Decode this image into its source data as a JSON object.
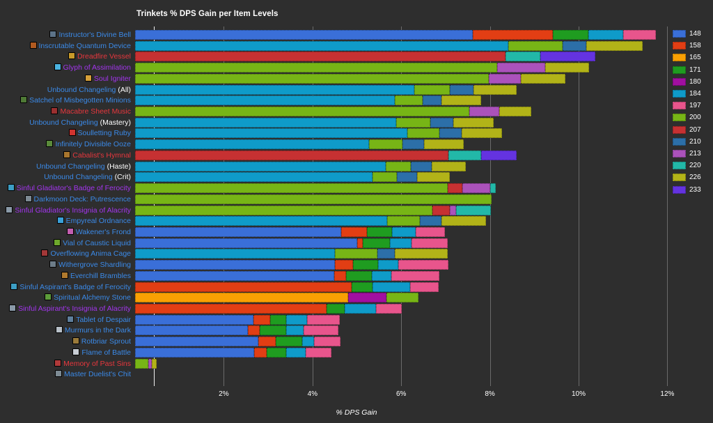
{
  "chart_data": {
    "type": "bar",
    "orientation": "horizontal",
    "stacked": true,
    "title": "Trinkets % DPS Gain per Item Levels",
    "xlabel": "% DPS Gain",
    "ylabel": "",
    "xlim": [
      0,
      12.6
    ],
    "xticks": [
      "2%",
      "4%",
      "6%",
      "8%",
      "10%",
      "12%"
    ],
    "xtick_values": [
      2,
      4,
      6,
      8,
      10,
      12
    ],
    "grid": true,
    "legend_position": "right",
    "legend_title": "",
    "series": [
      {
        "name": "148",
        "color": "#3a6fd8"
      },
      {
        "name": "158",
        "color": "#e23e14"
      },
      {
        "name": "165",
        "color": "#f9a003"
      },
      {
        "name": "171",
        "color": "#1f9c20"
      },
      {
        "name": "180",
        "color": "#a10fa1"
      },
      {
        "name": "184",
        "color": "#0f9bc9"
      },
      {
        "name": "197",
        "color": "#e8558c"
      },
      {
        "name": "200",
        "color": "#77b516"
      },
      {
        "name": "207",
        "color": "#c63132"
      },
      {
        "name": "210",
        "color": "#2c6fa8"
      },
      {
        "name": "213",
        "color": "#ab52bb"
      },
      {
        "name": "220",
        "color": "#22b8a8"
      },
      {
        "name": "226",
        "color": "#b2b318"
      },
      {
        "name": "233",
        "color": "#6433e0"
      }
    ],
    "categories": [
      {
        "label": "Instructor's Divine Bell",
        "suffix": "",
        "quality": "#3b8ae8",
        "icon": "#5d7388",
        "icon_name": "trinket-icon-instructors-divine-bell",
        "segments": [
          {
            "series": "148",
            "value": 7.62
          },
          {
            "series": "158",
            "value": 1.8
          },
          {
            "series": "171",
            "value": 0.8
          },
          {
            "series": "184",
            "value": 0.78
          },
          {
            "series": "197",
            "value": 0.74
          }
        ],
        "total": 11.74
      },
      {
        "label": "Inscrutable Quantum Device",
        "suffix": "",
        "quality": "#3b8ae8",
        "icon": "#b05a20",
        "icon_name": "trinket-icon-inscrutable-quantum-device",
        "segments": [
          {
            "series": "184",
            "value": 8.42
          },
          {
            "series": "200",
            "value": 1.22
          },
          {
            "series": "210",
            "value": 0.54
          },
          {
            "series": "226",
            "value": 1.26
          }
        ],
        "total": 11.44
      },
      {
        "label": "Dreadfire Vessel",
        "suffix": "",
        "quality": "#e8373d",
        "icon": "#c79a2a",
        "icon_name": "trinket-icon-dreadfire-vessel",
        "segments": [
          {
            "series": "207",
            "value": 8.35
          },
          {
            "series": "220",
            "value": 0.78
          },
          {
            "series": "233",
            "value": 1.25
          }
        ],
        "total": 10.38
      },
      {
        "label": "Glyph of Assimilation",
        "suffix": "",
        "quality": "#a335ee",
        "icon": "#4ab3e0",
        "icon_name": "trinket-icon-glyph-of-assimilation",
        "segments": [
          {
            "series": "200",
            "value": 8.17
          },
          {
            "series": "213",
            "value": 1.08
          },
          {
            "series": "226",
            "value": 0.99
          }
        ],
        "total": 10.24
      },
      {
        "label": "Soul Igniter",
        "suffix": "",
        "quality": "#a335ee",
        "icon": "#d6a03a",
        "icon_name": "trinket-icon-soul-igniter",
        "segments": [
          {
            "series": "200",
            "value": 7.97
          },
          {
            "series": "213",
            "value": 0.73
          },
          {
            "series": "226",
            "value": 1.0
          }
        ],
        "total": 9.7
      },
      {
        "label": "Unbound Changeling",
        "suffix": " (All)",
        "quality": "#3b8ae8",
        "icon": "",
        "icon_name": "",
        "segments": [
          {
            "series": "184",
            "value": 6.3
          },
          {
            "series": "200",
            "value": 0.8
          },
          {
            "series": "210",
            "value": 0.53
          },
          {
            "series": "226",
            "value": 0.97
          }
        ],
        "total": 8.6
      },
      {
        "label": "Satchel of Misbegotten Minions",
        "suffix": "",
        "quality": "#3b8ae8",
        "icon": "#4f7a36",
        "icon_name": "trinket-icon-satchel-of-misbegotten-minions",
        "segments": [
          {
            "series": "184",
            "value": 5.86
          },
          {
            "series": "200",
            "value": 0.62
          },
          {
            "series": "210",
            "value": 0.42
          },
          {
            "series": "226",
            "value": 0.91
          }
        ],
        "total": 7.81
      },
      {
        "label": "Macabre Sheet Music",
        "suffix": "",
        "quality": "#e8373d",
        "icon": "#9a3030",
        "icon_name": "trinket-icon-macabre-sheet-music",
        "segments": [
          {
            "series": "200",
            "value": 7.53
          },
          {
            "series": "213",
            "value": 0.68
          },
          {
            "series": "226",
            "value": 0.72
          }
        ],
        "total": 8.93
      },
      {
        "label": "Unbound Changeling",
        "suffix": " (Mastery)",
        "quality": "#3b8ae8",
        "icon": "",
        "icon_name": "",
        "segments": [
          {
            "series": "184",
            "value": 5.88
          },
          {
            "series": "200",
            "value": 0.78
          },
          {
            "series": "210",
            "value": 0.52
          },
          {
            "series": "226",
            "value": 0.91
          }
        ],
        "total": 8.09
      },
      {
        "label": "Soulletting Ruby",
        "suffix": "",
        "quality": "#3b8ae8",
        "icon": "#d0342f",
        "icon_name": "trinket-icon-soulletting-ruby",
        "segments": [
          {
            "series": "184",
            "value": 6.14
          },
          {
            "series": "200",
            "value": 0.72
          },
          {
            "series": "210",
            "value": 0.5
          },
          {
            "series": "226",
            "value": 0.92
          }
        ],
        "total": 8.28
      },
      {
        "label": "Infinitely Divisible Ooze",
        "suffix": "",
        "quality": "#3b8ae8",
        "icon": "#5a8a3a",
        "icon_name": "trinket-icon-infinitely-divisible-ooze",
        "segments": [
          {
            "series": "184",
            "value": 5.27
          },
          {
            "series": "200",
            "value": 0.76
          },
          {
            "series": "210",
            "value": 0.49
          },
          {
            "series": "226",
            "value": 0.89
          }
        ],
        "total": 7.41
      },
      {
        "label": "Cabalist's Hymnal",
        "suffix": "",
        "quality": "#e8373d",
        "icon": "#a8762e",
        "icon_name": "trinket-icon-cabalists-hymnal",
        "segments": [
          {
            "series": "207",
            "value": 7.07
          },
          {
            "series": "220",
            "value": 0.74
          },
          {
            "series": "233",
            "value": 0.8
          }
        ],
        "total": 8.61
      },
      {
        "label": "Unbound Changeling",
        "suffix": " (Haste)",
        "quality": "#3b8ae8",
        "icon": "",
        "icon_name": "",
        "segments": [
          {
            "series": "184",
            "value": 5.65
          },
          {
            "series": "200",
            "value": 0.56
          },
          {
            "series": "210",
            "value": 0.48
          },
          {
            "series": "226",
            "value": 0.77
          }
        ],
        "total": 7.46
      },
      {
        "label": "Unbound Changeling",
        "suffix": " (Crit)",
        "quality": "#3b8ae8",
        "icon": "",
        "icon_name": "",
        "segments": [
          {
            "series": "184",
            "value": 5.36
          },
          {
            "series": "200",
            "value": 0.54
          },
          {
            "series": "210",
            "value": 0.46
          },
          {
            "series": "226",
            "value": 0.74
          }
        ],
        "total": 7.1
      },
      {
        "label": "Sinful Gladiator's Badge of Ferocity",
        "suffix": "",
        "quality": "#a335ee",
        "icon": "#3d9ec4",
        "icon_name": "trinket-icon-sinful-gladiators-badge-of-ferocity",
        "segments": [
          {
            "series": "200",
            "value": 7.05
          },
          {
            "series": "207",
            "value": 0.33
          },
          {
            "series": "213",
            "value": 0.62
          },
          {
            "series": "220",
            "value": 0.13
          }
        ],
        "total": 8.13
      },
      {
        "label": "Darkmoon Deck: Putrescence",
        "suffix": "",
        "quality": "#3b8ae8",
        "icon": "#7d8a93",
        "icon_name": "trinket-icon-darkmoon-deck-putrescence",
        "segments": [
          {
            "series": "200",
            "value": 8.04
          }
        ],
        "total": 8.04
      },
      {
        "label": "Sinful Gladiator's Insignia of Alacrity",
        "suffix": "",
        "quality": "#a335ee",
        "icon": "#8a9aa8",
        "icon_name": "trinket-icon-sinful-gladiators-insignia-of-alacrity",
        "segments": [
          {
            "series": "200",
            "value": 6.71
          },
          {
            "series": "207",
            "value": 0.38
          },
          {
            "series": "213",
            "value": 0.14
          },
          {
            "series": "220",
            "value": 0.8
          }
        ],
        "total": 8.03
      },
      {
        "label": "Empyreal Ordnance",
        "suffix": "",
        "quality": "#3b8ae8",
        "icon": "#3aa0d8",
        "icon_name": "trinket-icon-empyreal-ordnance",
        "segments": [
          {
            "series": "184",
            "value": 5.69
          },
          {
            "series": "200",
            "value": 0.73
          },
          {
            "series": "210",
            "value": 0.48
          },
          {
            "series": "226",
            "value": 1.02
          }
        ],
        "total": 7.92
      },
      {
        "label": "Wakener's Frond",
        "suffix": "",
        "quality": "#3b8ae8",
        "icon": "#c45fb0",
        "icon_name": "trinket-icon-wakeners-frond",
        "segments": [
          {
            "series": "148",
            "value": 4.65
          },
          {
            "series": "158",
            "value": 0.58
          },
          {
            "series": "171",
            "value": 0.56
          },
          {
            "series": "184",
            "value": 0.54
          },
          {
            "series": "197",
            "value": 0.66
          }
        ],
        "total": 6.99
      },
      {
        "label": "Vial of Caustic Liquid",
        "suffix": "",
        "quality": "#3b8ae8",
        "icon": "#6ea82c",
        "icon_name": "trinket-icon-vial-of-caustic-liquid",
        "segments": [
          {
            "series": "148",
            "value": 5.01
          },
          {
            "series": "158",
            "value": 0.12
          },
          {
            "series": "171",
            "value": 0.61
          },
          {
            "series": "184",
            "value": 0.49
          },
          {
            "series": "197",
            "value": 0.82
          }
        ],
        "total": 7.05
      },
      {
        "label": "Overflowing Anima Cage",
        "suffix": "",
        "quality": "#3b8ae8",
        "icon": "#a33838",
        "icon_name": "trinket-icon-overflowing-anima-cage",
        "segments": [
          {
            "series": "184",
            "value": 4.5
          },
          {
            "series": "200",
            "value": 0.96
          },
          {
            "series": "210",
            "value": 0.4
          },
          {
            "series": "226",
            "value": 1.19
          }
        ],
        "total": 7.05
      },
      {
        "label": "Withergrove Shardling",
        "suffix": "",
        "quality": "#3b8ae8",
        "icon": "#6d7c88",
        "icon_name": "trinket-icon-withergrove-shardling",
        "segments": [
          {
            "series": "148",
            "value": 4.51
          },
          {
            "series": "158",
            "value": 0.41
          },
          {
            "series": "171",
            "value": 0.56
          },
          {
            "series": "184",
            "value": 0.46
          },
          {
            "series": "197",
            "value": 1.13
          }
        ],
        "total": 7.07
      },
      {
        "label": "Everchill Brambles",
        "suffix": "",
        "quality": "#3b8ae8",
        "icon": "#b07a2e",
        "icon_name": "trinket-icon-everchill-brambles",
        "segments": [
          {
            "series": "148",
            "value": 4.49
          },
          {
            "series": "158",
            "value": 0.26
          },
          {
            "series": "171",
            "value": 0.59
          },
          {
            "series": "184",
            "value": 0.43
          },
          {
            "series": "197",
            "value": 1.09
          }
        ],
        "total": 6.86
      },
      {
        "label": "Sinful Aspirant's Badge of Ferocity",
        "suffix": "",
        "quality": "#3b8ae8",
        "icon": "#3d9ec4",
        "icon_name": "trinket-icon-sinful-aspirants-badge-of-ferocity",
        "segments": [
          {
            "series": "158",
            "value": 4.89
          },
          {
            "series": "171",
            "value": 0.47
          },
          {
            "series": "184",
            "value": 0.84
          },
          {
            "series": "197",
            "value": 0.64
          }
        ],
        "total": 6.84
      },
      {
        "label": "Spiritual Alchemy Stone",
        "suffix": "",
        "quality": "#3b8ae8",
        "icon": "#5d9c3a",
        "icon_name": "trinket-icon-spiritual-alchemy-stone",
        "segments": [
          {
            "series": "165",
            "value": 4.81
          },
          {
            "series": "180",
            "value": 0.85
          },
          {
            "series": "200",
            "value": 0.73
          }
        ],
        "total": 6.39
      },
      {
        "label": "Sinful Aspirant's Insignia of Alacrity",
        "suffix": "",
        "quality": "#a335ee",
        "icon": "#8a9aa8",
        "icon_name": "trinket-icon-sinful-aspirants-insignia-of-alacrity",
        "segments": [
          {
            "series": "158",
            "value": 4.31
          },
          {
            "series": "171",
            "value": 0.42
          },
          {
            "series": "184",
            "value": 0.7
          },
          {
            "series": "197",
            "value": 0.59
          }
        ],
        "total": 6.02
      },
      {
        "label": "Tablet of Despair",
        "suffix": "",
        "quality": "#3b8ae8",
        "icon": "#5f7f9c",
        "icon_name": "trinket-icon-tablet-of-despair",
        "segments": [
          {
            "series": "148",
            "value": 2.67
          },
          {
            "series": "158",
            "value": 0.37
          },
          {
            "series": "171",
            "value": 0.37
          },
          {
            "series": "184",
            "value": 0.46
          },
          {
            "series": "197",
            "value": 0.74
          }
        ],
        "total": 4.61
      },
      {
        "label": "Murmurs in the Dark",
        "suffix": "",
        "quality": "#3b8ae8",
        "icon": "#b8c0c8",
        "icon_name": "trinket-icon-murmurs-in-the-dark",
        "segments": [
          {
            "series": "148",
            "value": 2.54
          },
          {
            "series": "158",
            "value": 0.27
          },
          {
            "series": "171",
            "value": 0.6
          },
          {
            "series": "184",
            "value": 0.39
          },
          {
            "series": "197",
            "value": 0.78
          }
        ],
        "total": 4.58
      },
      {
        "label": "Rotbriar Sprout",
        "suffix": "",
        "quality": "#3b8ae8",
        "icon": "#9a7a3a",
        "icon_name": "trinket-icon-rotbriar-sprout",
        "segments": [
          {
            "series": "148",
            "value": 2.78
          },
          {
            "series": "158",
            "value": 0.39
          },
          {
            "series": "171",
            "value": 0.6
          },
          {
            "series": "184",
            "value": 0.26
          },
          {
            "series": "197",
            "value": 0.6
          }
        ],
        "total": 4.63
      },
      {
        "label": "Flame of Battle",
        "suffix": "",
        "quality": "#3b8ae8",
        "icon": "#c8cdd4",
        "icon_name": "trinket-icon-flame-of-battle",
        "segments": [
          {
            "series": "148",
            "value": 2.68
          },
          {
            "series": "158",
            "value": 0.29
          },
          {
            "series": "171",
            "value": 0.44
          },
          {
            "series": "184",
            "value": 0.44
          },
          {
            "series": "197",
            "value": 0.58
          }
        ],
        "total": 4.43
      },
      {
        "label": "Memory of Past Sins",
        "suffix": "",
        "quality": "#e8373d",
        "icon": "#b03a3a",
        "icon_name": "trinket-icon-memory-of-past-sins",
        "segments": [
          {
            "series": "200",
            "value": 0.3
          },
          {
            "series": "213",
            "value": 0.07
          },
          {
            "series": "226",
            "value": 0.12
          }
        ],
        "total": 0.49
      },
      {
        "label": "Master Duelist's Chit",
        "suffix": "",
        "quality": "#3b8ae8",
        "icon": "#7d8a93",
        "icon_name": "trinket-icon-master-duelists-chit",
        "segments": [],
        "total": 0.0
      }
    ]
  }
}
